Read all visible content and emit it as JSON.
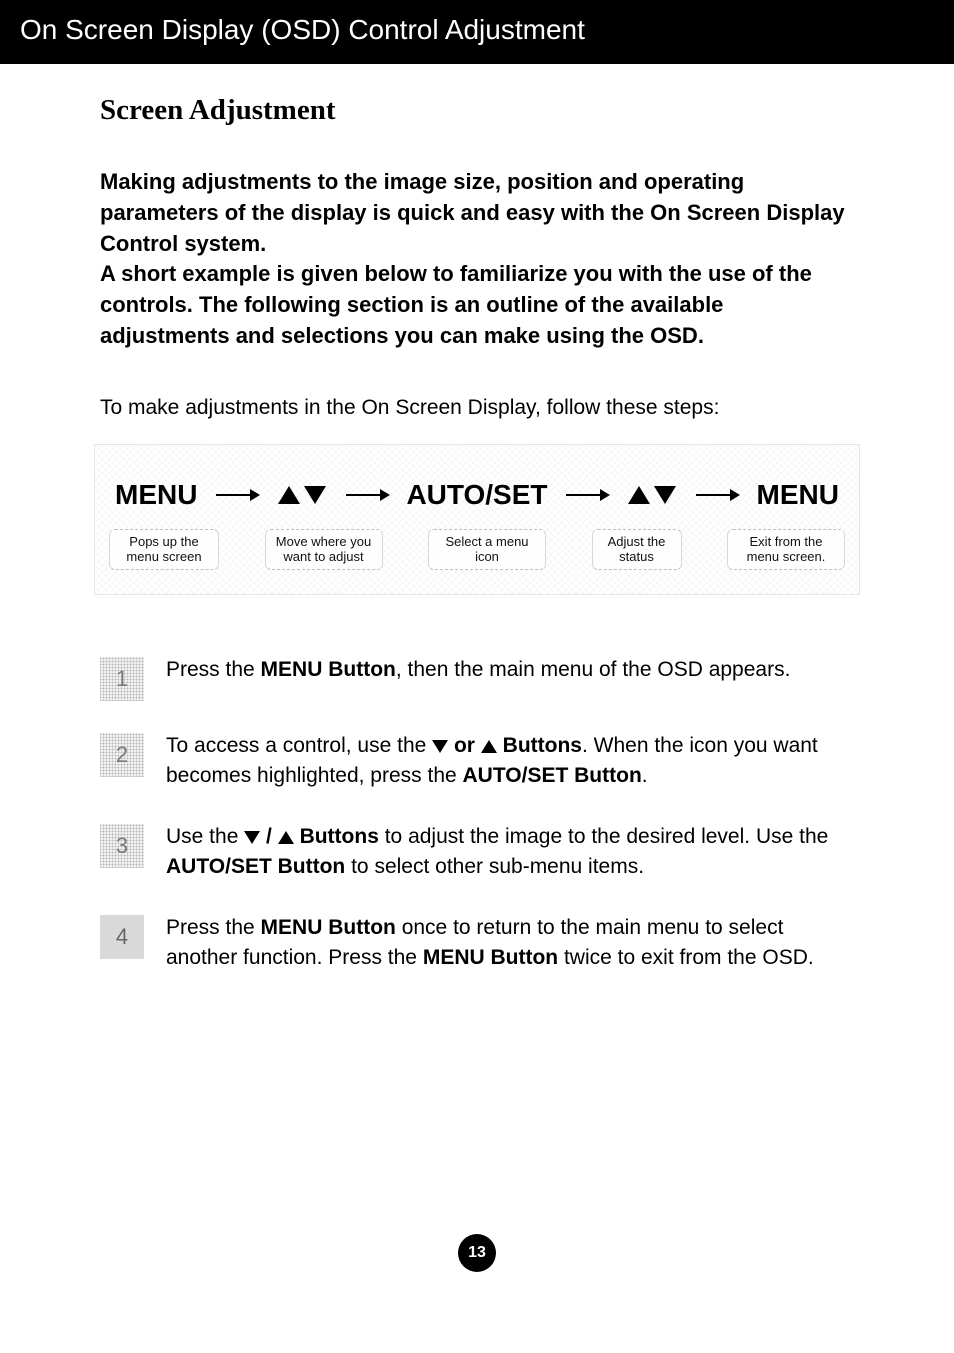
{
  "header": "On Screen Display (OSD) Control Adjustment",
  "title": "Screen Adjustment",
  "intro": "Making adjustments to the image size, position and operating parameters of the display is quick and easy with the On Screen Display Control system.\nA short example is given below to familiarize you with the use of the controls. The following section is an outline of the available adjustments and selections you can make using the OSD.",
  "lead": "To make adjustments in the On Screen Display, follow these steps:",
  "flow": {
    "menu1": "MENU",
    "autoset": "AUTO/SET",
    "menu2": "MENU",
    "captions": {
      "c1": "Pops up the menu screen",
      "c2": "Move where you want to adjust",
      "c3": "Select a menu icon",
      "c4": "Adjust the status",
      "c5": "Exit from the menu screen."
    }
  },
  "steps": {
    "s1": {
      "num": "1",
      "pre": "Press the ",
      "b1": "MENU Button",
      "post": ", then the main menu of the OSD appears."
    },
    "s2": {
      "num": "2",
      "pre": "To access a control, use the  ",
      "b_or": " or ",
      "b_buttons": " Buttons",
      "mid": ". When the icon you want becomes highlighted, press the  ",
      "b_autoset": "AUTO/SET Button",
      "post": "."
    },
    "s3": {
      "num": "3",
      "pre": "Use the  ",
      "slash": " / ",
      "b_buttons": " Buttons",
      "mid": " to adjust the image to the desired level. Use the ",
      "b_autoset": "AUTO/SET Button",
      "post": " to select other sub-menu items."
    },
    "s4": {
      "num": "4",
      "pre": "Press the ",
      "b1": "MENU Button",
      "mid": " once to return to the main menu to select another function. Press the ",
      "b2": "MENU Button",
      "post": " twice to exit from the OSD."
    }
  },
  "page_number": "13"
}
